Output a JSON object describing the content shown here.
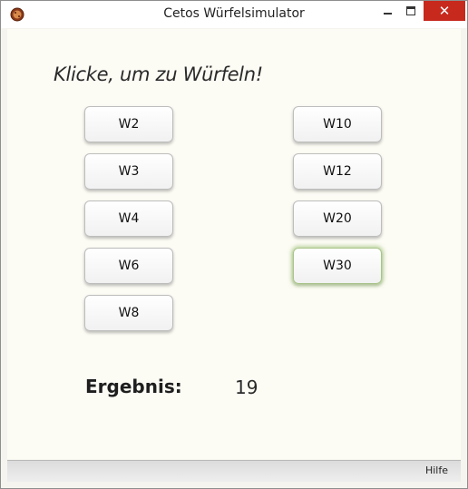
{
  "window": {
    "title": "Cetos Würfelsimulator",
    "close_glyph": "✕"
  },
  "main": {
    "heading": "Klicke, um zu Würfeln!",
    "buttons": {
      "w2": "W2",
      "w3": "W3",
      "w4": "W4",
      "w6": "W6",
      "w8": "W8",
      "w10": "W10",
      "w12": "W12",
      "w20": "W20",
      "w30": "W30"
    },
    "result_label": "Ergebnis:",
    "result_value": "19"
  },
  "statusbar": {
    "help_label": "Hilfe"
  },
  "icons": {
    "app": "dice-app-icon",
    "minimize": "minimize-icon",
    "maximize": "maximize-icon",
    "close": "close-icon"
  },
  "colors": {
    "close_button": "#c7291d",
    "background": "#fcfbf4",
    "focus_glow": "#a9c48a"
  }
}
